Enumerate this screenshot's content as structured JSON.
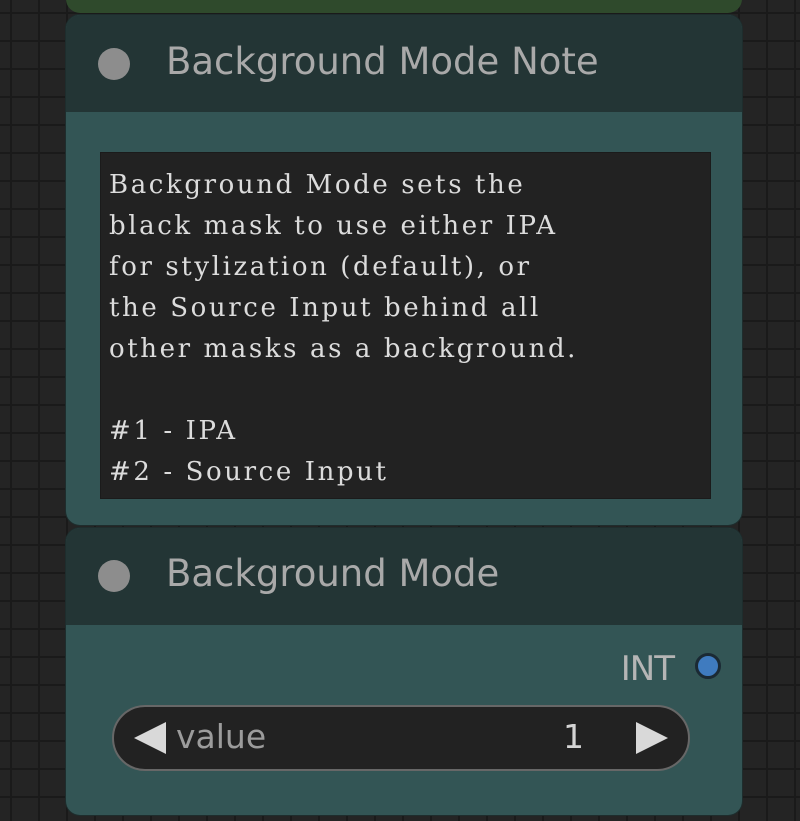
{
  "note_node": {
    "title": "Background Mode Note",
    "text": "Background Mode sets the\nblack mask to use either IPA\nfor stylization (default), or\nthe Source Input behind all\nother masks as a background.\n\n#1 - IPA\n#2 - Source Input"
  },
  "mode_node": {
    "title": "Background Mode",
    "output": {
      "label": "INT",
      "color": "#3f7bbf"
    },
    "widget": {
      "label": "value",
      "value": "1",
      "decrement_icon": "triangle-left-icon",
      "increment_icon": "triangle-right-icon"
    }
  },
  "colors": {
    "node_body": "#335555",
    "node_header": "#233535",
    "above_node": "#2f4a2c",
    "canvas": "#242424"
  }
}
